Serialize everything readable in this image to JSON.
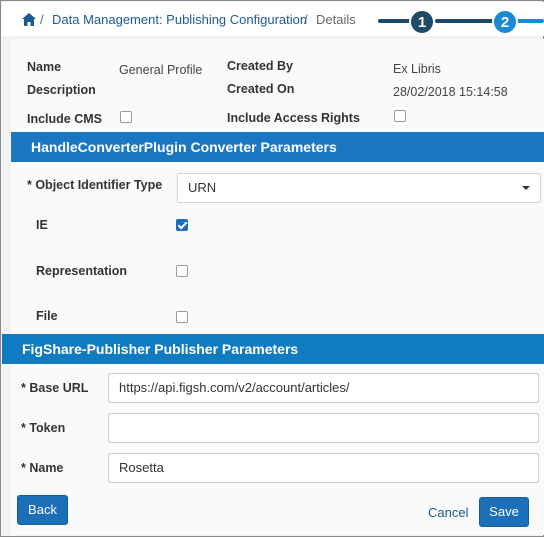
{
  "breadcrumb": {
    "link": "Data Management: Publishing Configuration",
    "separator": "/",
    "current": "Details"
  },
  "stepper": {
    "step1": "1",
    "step2": "2"
  },
  "profile": {
    "name_label": "Name",
    "name_value": "General Profile",
    "description_label": "Description",
    "created_by_label": "Created By",
    "created_by_value": "Ex Libris",
    "created_on_label": "Created On",
    "created_on_value": "28/02/2018 15:14:58",
    "include_cms_label": "Include CMS",
    "include_cms_checked": false,
    "include_access_rights_label": "Include Access Rights",
    "include_access_rights_checked": false
  },
  "converter": {
    "title": "HandleConverterPlugin Converter Parameters",
    "object_identifier_label": "* Object Identifier Type",
    "object_identifier_value": "URN",
    "ie_label": "IE",
    "ie_checked": true,
    "representation_label": "Representation",
    "representation_checked": false,
    "file_label": "File",
    "file_checked": false
  },
  "publisher": {
    "title": "FigShare-Publisher Publisher Parameters",
    "base_url_label": "* Base URL",
    "base_url_value": "https://api.figsh.com/v2/account/articles/",
    "token_label": "* Token",
    "token_value": "",
    "name_label": "* Name",
    "name_value": "Rosetta"
  },
  "actions": {
    "back": "Back",
    "cancel": "Cancel",
    "save": "Save"
  },
  "colors": {
    "accent": "#1a78c2",
    "stepper_dark": "#1e4a68",
    "stepper_active": "#1a8ad1"
  }
}
